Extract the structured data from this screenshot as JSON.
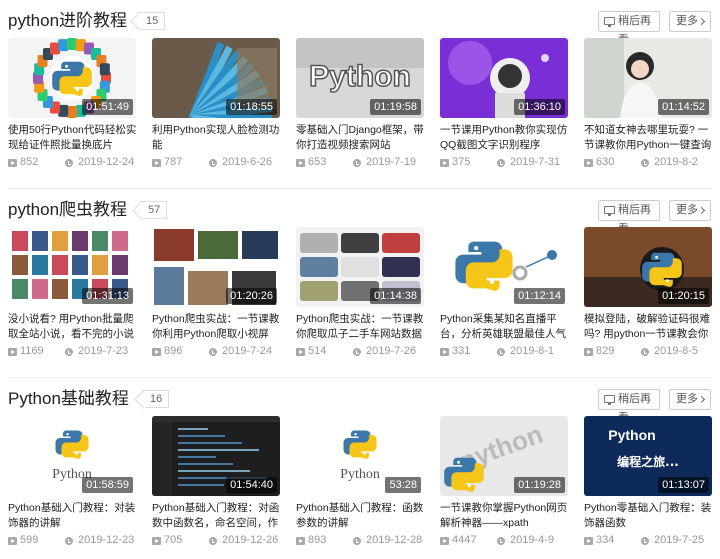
{
  "sections": [
    {
      "title": "python进阶教程",
      "count": "15",
      "watch_later": "稍后再看",
      "more": "更多",
      "videos": [
        {
          "duration": "01:51:49",
          "title": "使用50行Python代码轻松实现给证件照批量换底片",
          "plays": "852",
          "date": "2019-12-24",
          "thumb": "python-logo-circle"
        },
        {
          "duration": "01:18:55",
          "title": "利用Python实现人脸检测功能",
          "plays": "787",
          "date": "2019-6-26",
          "thumb": "blue-fan"
        },
        {
          "duration": "01:19:58",
          "title": "零基础入门Django框架，带你打造视频搜索网站",
          "plays": "653",
          "date": "2019-7-19",
          "thumb": "python-text"
        },
        {
          "duration": "01:36:10",
          "title": "一节课用Python教你实现仿QQ截图文字识别程序",
          "plays": "375",
          "date": "2019-7-31",
          "thumb": "astronaut"
        },
        {
          "duration": "01:14:52",
          "title": "不知道女神去哪里玩耍? 一节课教你用Python一键查询照",
          "plays": "630",
          "date": "2019-8-2",
          "thumb": "girl"
        }
      ]
    },
    {
      "title": "python爬虫教程",
      "count": "57",
      "watch_later": "稍后再看",
      "more": "更多",
      "videos": [
        {
          "duration": "01:31:13",
          "title": "没小说看? 用Python批量爬取全站小说，看不完的小说资",
          "plays": "1169",
          "date": "2019-7-23",
          "thumb": "book-grid"
        },
        {
          "duration": "01:20:26",
          "title": "Python爬虫实战：一节课教你利用Python爬取小视屏",
          "plays": "896",
          "date": "2019-7-24",
          "thumb": "news"
        },
        {
          "duration": "01:14:38",
          "title": "Python爬虫实战：一节课教你爬取瓜子二手车网站数据并",
          "plays": "514",
          "date": "2019-7-26",
          "thumb": "cars"
        },
        {
          "duration": "01:12:14",
          "title": "Python采集某知名直播平台，分析英雄联盟最佳人气主",
          "plays": "331",
          "date": "2019-8-1",
          "thumb": "python-gears"
        },
        {
          "duration": "01:20:15",
          "title": "模拟登陆，破解验证码很难吗? 用python一节课教会你",
          "plays": "829",
          "date": "2019-8-5",
          "thumb": "python-dark"
        }
      ]
    },
    {
      "title": "Python基础教程",
      "count": "16",
      "watch_later": "稍后再看",
      "more": "更多",
      "videos": [
        {
          "duration": "01:58:59",
          "title": "Python基础入门教程：对装饰器的讲解",
          "plays": "599",
          "date": "2019-12-23",
          "thumb": "python-white",
          "logo_text": "Python"
        },
        {
          "duration": "01:54:40",
          "title": "Python基础入门教程：对函数中函数名，命名空间，作",
          "plays": "705",
          "date": "2019-12-26",
          "thumb": "code-editor"
        },
        {
          "duration": "53:28",
          "title": "Python基础入门教程：函数参数的讲解",
          "plays": "893",
          "date": "2019-12-28",
          "thumb": "python-white",
          "logo_text": "Python"
        },
        {
          "duration": "01:19:28",
          "title": "一节课教你掌握Python网页解析神器——xpath",
          "plays": "4447",
          "date": "2019-4-9",
          "thumb": "python-3d"
        },
        {
          "duration": "01:13:07",
          "title": "Python零基础入门教程：装饰器函数",
          "plays": "334",
          "date": "2019-7-25",
          "thumb": "python-banner",
          "banner_title": "Python",
          "banner_sub": "编程之旅..."
        }
      ]
    }
  ],
  "colors": {
    "python_blue": "#3b77a8",
    "python_yellow": "#f5c518",
    "meta_gray": "#999999"
  }
}
